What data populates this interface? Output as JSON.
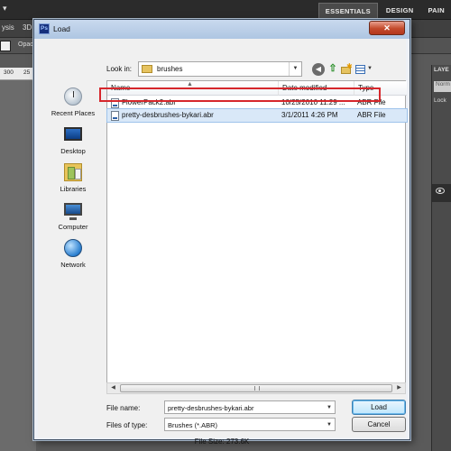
{
  "photoshop": {
    "workspace_tabs": [
      "ESSENTIALS",
      "DESIGN",
      "PAIN"
    ],
    "menu_fragments": [
      "ysis",
      "3D"
    ],
    "options_label": "Opac",
    "ruler_ticks": [
      "300",
      "25"
    ],
    "panel_header": "LAYE",
    "panel_blend": "Norm",
    "panel_lock": "Lock"
  },
  "dialog": {
    "title": "Load",
    "app_icon_text": "Ps",
    "look_in_label": "Look in:",
    "look_in_value": "brushes",
    "places": [
      "Recent Places",
      "Desktop",
      "Libraries",
      "Computer",
      "Network"
    ],
    "columns": [
      "Name",
      "Date modified",
      "Type"
    ],
    "files": [
      {
        "name": "FlowerPack2.abr",
        "date": "10/25/2010 11:29 ...",
        "type": "ABR File"
      },
      {
        "name": "pretty-desbrushes-bykari.abr",
        "date": "3/1/2011 4:26 PM",
        "type": "ABR File"
      }
    ],
    "file_name_label": "File name:",
    "file_name_value": "pretty-desbrushes-bykari.abr",
    "file_type_label": "Files of type:",
    "file_type_value": "Brushes (*.ABR)",
    "load_button": "Load",
    "cancel_button": "Cancel",
    "file_size": "File Size: 273.6K"
  },
  "colors": {
    "highlight": "#d6272c",
    "selection": "#d9e8f8"
  }
}
